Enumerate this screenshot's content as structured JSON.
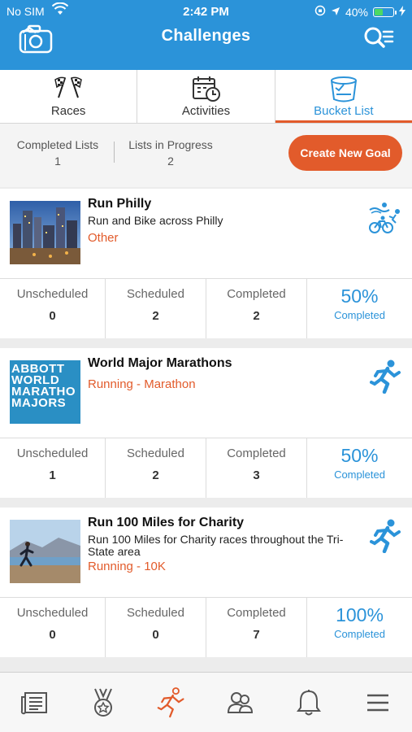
{
  "status": {
    "carrier": "No SIM",
    "time": "2:42 PM",
    "battery": "40%",
    "battery_level": 0.4
  },
  "header": {
    "title": "Challenges"
  },
  "tabs": [
    {
      "label": "Races",
      "icon": "checkered-flags-icon",
      "active": false
    },
    {
      "label": "Activities",
      "icon": "calendar-clock-icon",
      "active": false
    },
    {
      "label": "Bucket List",
      "icon": "bucket-icon",
      "active": true
    }
  ],
  "summary": {
    "completed_label": "Completed Lists",
    "completed_value": "1",
    "progress_label": "Lists in Progress",
    "progress_value": "2",
    "create_button": "Create New Goal"
  },
  "goals": [
    {
      "name": "Run Philly",
      "description": "Run and Bike across Philly",
      "category": "Other",
      "sport_icon": "swim-bike-run-icon",
      "stats": {
        "unscheduled_label": "Unscheduled",
        "unscheduled": "0",
        "scheduled_label": "Scheduled",
        "scheduled": "2",
        "completed_label": "Completed",
        "completed": "2"
      },
      "percent": "50%",
      "percent_label": "Completed"
    },
    {
      "name": "World Major Marathons",
      "description": "",
      "category": "Running - Marathon",
      "logo_text": [
        "ABBOTT",
        "WORLD",
        "MARATHO",
        "MAJORS"
      ],
      "sport_icon": "runner-icon",
      "stats": {
        "unscheduled_label": "Unscheduled",
        "unscheduled": "1",
        "scheduled_label": "Scheduled",
        "scheduled": "2",
        "completed_label": "Completed",
        "completed": "3"
      },
      "percent": "50%",
      "percent_label": "Completed"
    },
    {
      "name": "Run 100 Miles for Charity",
      "description": "Run 100 Miles for Charity races throughout the Tri-State area",
      "category": "Running - 10K",
      "sport_icon": "runner-icon",
      "stats": {
        "unscheduled_label": "Unscheduled",
        "unscheduled": "0",
        "scheduled_label": "Scheduled",
        "scheduled": "0",
        "completed_label": "Completed",
        "completed": "7"
      },
      "percent": "100%",
      "percent_label": "Completed"
    }
  ],
  "bottom_nav": [
    "news-icon",
    "medal-icon",
    "runner-icon",
    "friends-icon",
    "bell-icon",
    "menu-icon"
  ],
  "colors": {
    "brand_blue": "#2b93d9",
    "accent_orange": "#e25b2b"
  }
}
